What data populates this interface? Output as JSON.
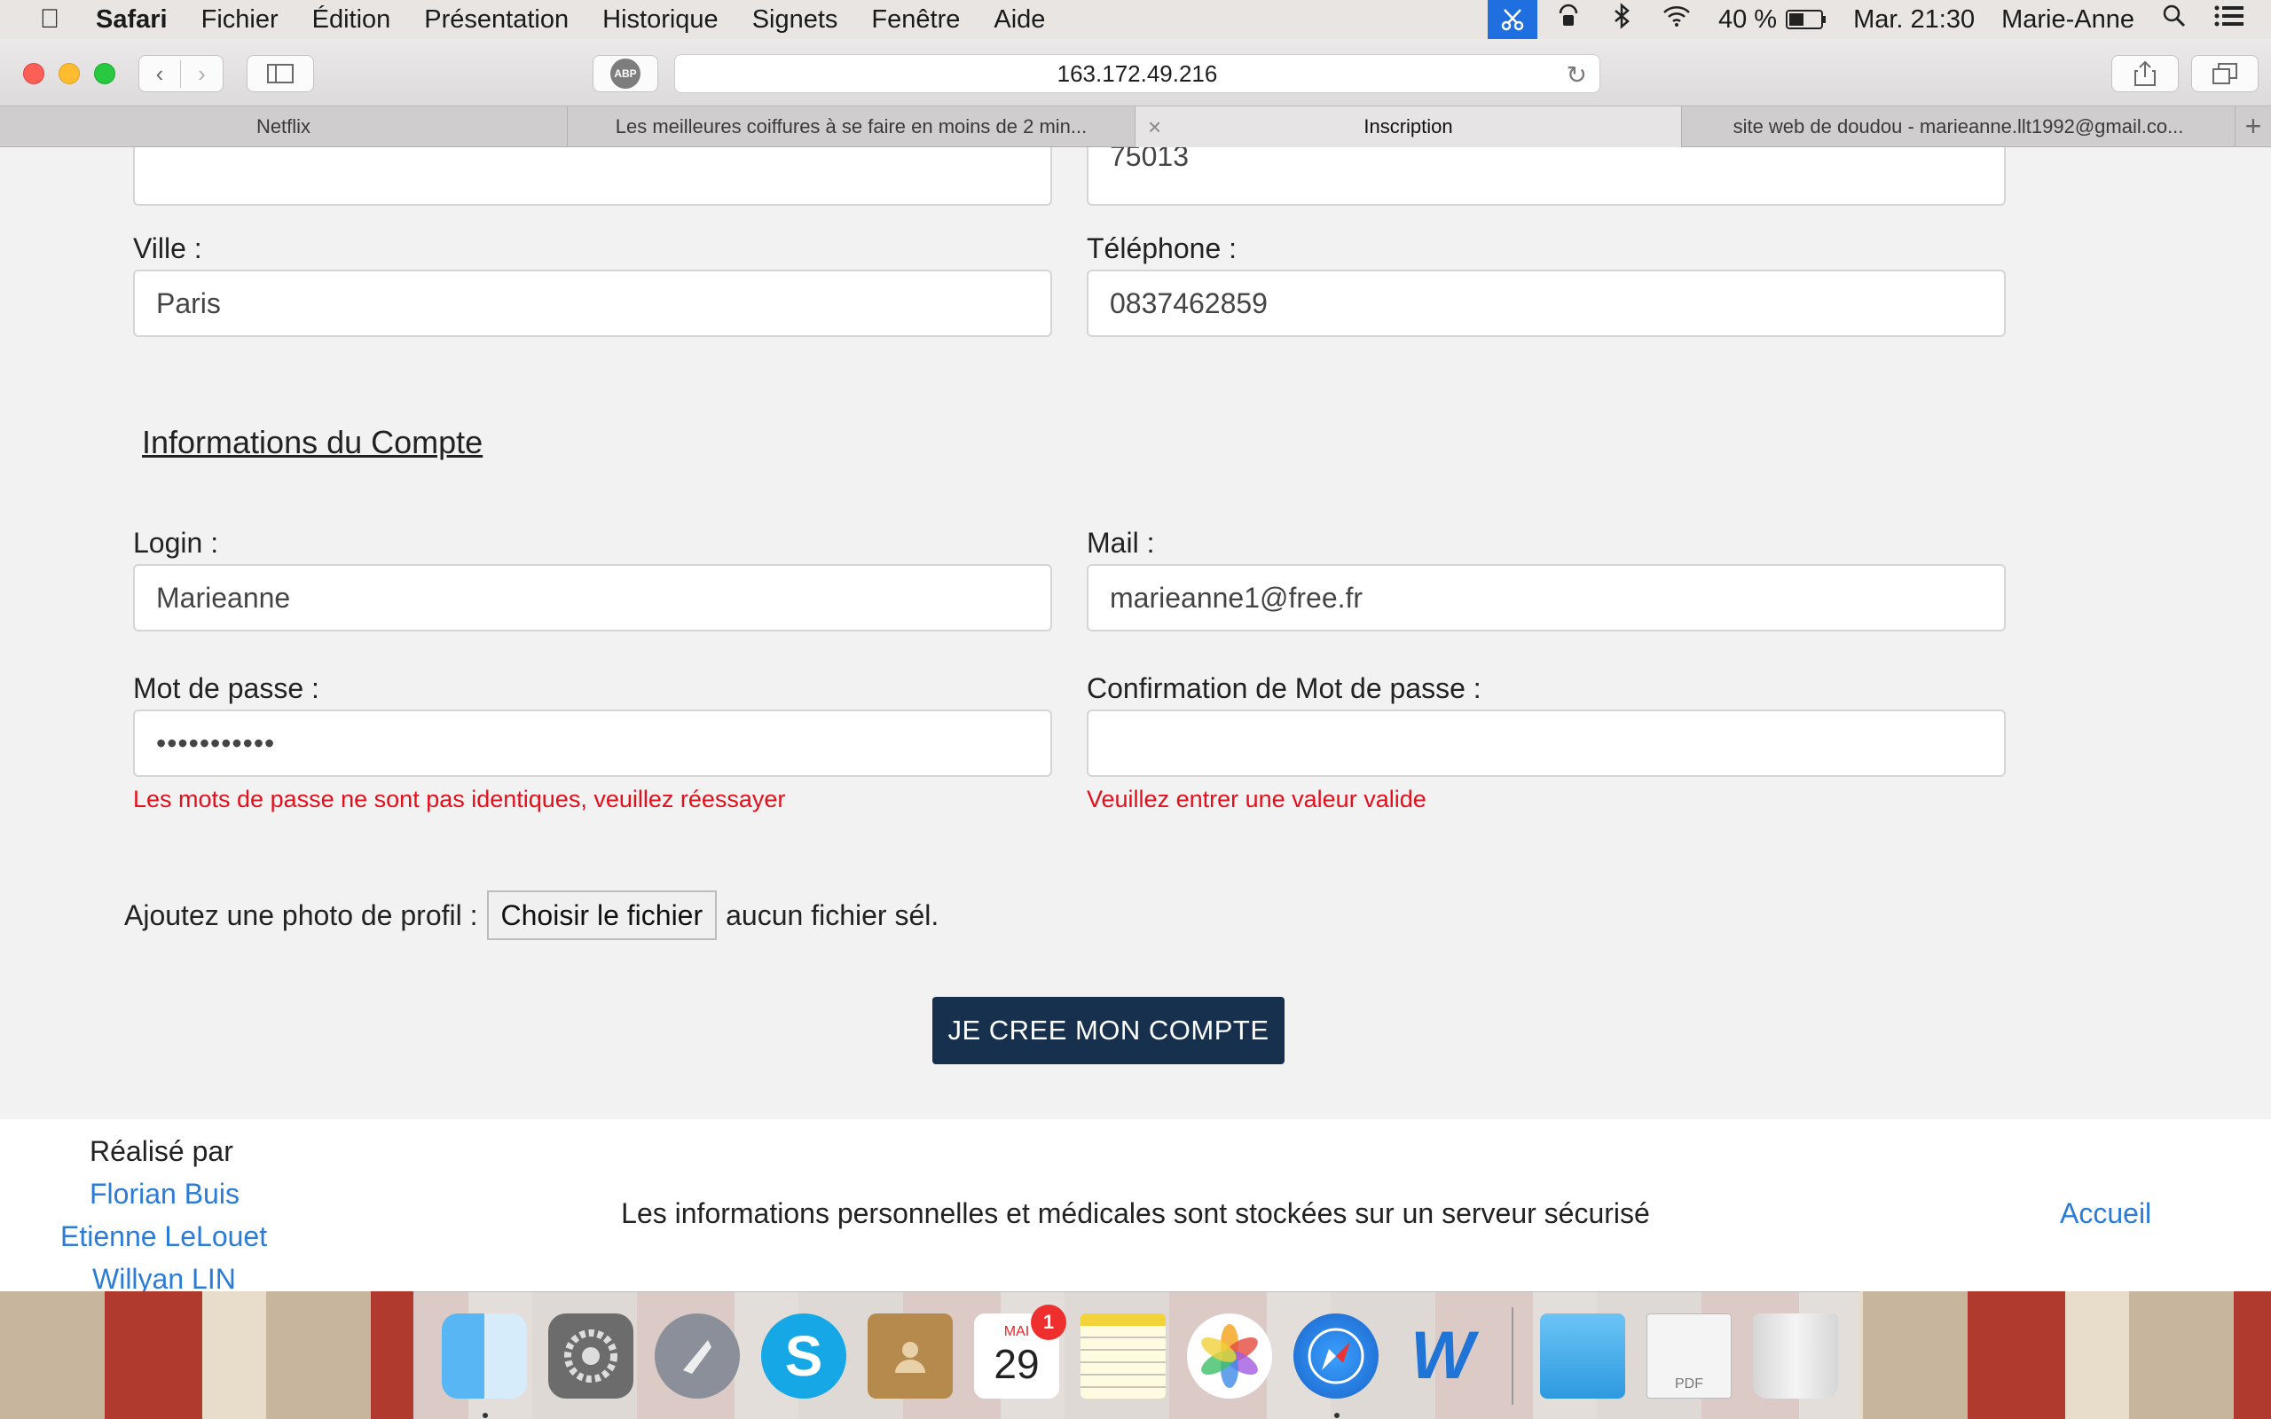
{
  "menubar": {
    "app_name": "Safari",
    "items": [
      "Fichier",
      "Édition",
      "Présentation",
      "Historique",
      "Signets",
      "Fenêtre",
      "Aide"
    ],
    "battery": "40 %",
    "clock": "Mar. 21:30",
    "user": "Marie-Anne"
  },
  "browser": {
    "url": "163.172.49.216",
    "abp_label": "ABP",
    "tabs": [
      {
        "label": "Netflix"
      },
      {
        "label": "Les meilleures coiffures à se faire en moins de 2 min..."
      },
      {
        "label": "Inscription"
      },
      {
        "label": "site web de doudou - marieanne.llt1992@gmail.co..."
      }
    ]
  },
  "form": {
    "partial_left_value": "",
    "partial_right_value": "75013",
    "city_label": "Ville :",
    "city_value": "Paris",
    "phone_label": "Téléphone :",
    "phone_value": "0837462859",
    "section_title": "Informations du Compte",
    "login_label": "Login :",
    "login_value": "Marieanne",
    "mail_label": "Mail :",
    "mail_value": "marieanne1@free.fr",
    "password_label": "Mot de passe :",
    "password_value": "•••••••••••",
    "password_error": "Les mots de passe ne sont pas identiques, veuillez réessayer",
    "confirm_label": "Confirmation de Mot de passe :",
    "confirm_value": "",
    "confirm_error": "Veuillez entrer une valeur valide",
    "photo_label": "Ajoutez une photo de profil :",
    "file_button": "Choisir le fichier",
    "file_status": "aucun fichier sél.",
    "submit_label": "JE CREE MON COMPTE"
  },
  "footer": {
    "credit_label": "Réalisé par",
    "authors": [
      "Florian Buis",
      "Etienne LeLouet",
      "Willyan LIN"
    ],
    "notice": "Les informations personnelles et médicales sont stockées sur un serveur sécurisé",
    "home_link": "Accueil"
  },
  "dock": {
    "calendar_month": "MAI",
    "calendar_day": "29",
    "calendar_badge": "1",
    "pdf_label": "PDF",
    "colors": {
      "accent": "#17304d",
      "error": "#e3101c",
      "link": "#2b7bd7"
    }
  }
}
